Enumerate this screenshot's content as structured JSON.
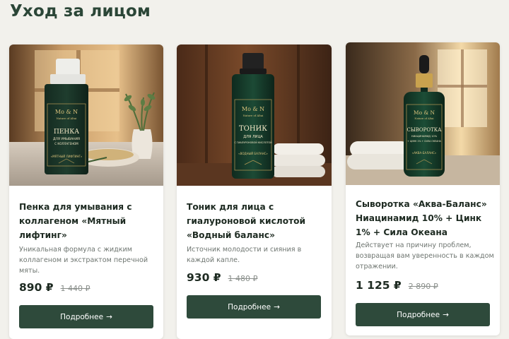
{
  "page": {
    "title": "Уход за лицом"
  },
  "colors": {
    "accent": "#2e4a3b",
    "title": "#2b4637",
    "background": "#f2f1ec"
  },
  "products": [
    {
      "name": "Пенка для умывания с коллагеном «Мятный лифтинг»",
      "description": "Уникальная формула с жидким коллагеном и экстрактом перечной мяты.",
      "price": "890 ₽",
      "old_price": "1 440 ₽",
      "button_label": "Подробнее",
      "button_icon": "arrow-right-icon",
      "image": {
        "brand": "Mo & N",
        "brand_sub": "Nature of Altai",
        "product_line1": "ПЕНКА",
        "product_line2": "ДЛЯ УМЫВАНИЯ",
        "product_line3": "С КОЛЛАГЕНОМ",
        "product_variant": "«МЯТНЫЙ ЛИФТИНГ»"
      }
    },
    {
      "name": "Тоник для лица с гиалуроновой кислотой «Водный баланс»",
      "description": "Источник молодости и сияния в каждой капле.",
      "price": "930 ₽",
      "old_price": "1 480 ₽",
      "button_label": "Подробнее",
      "button_icon": "arrow-right-icon",
      "image": {
        "brand": "Mo & N",
        "brand_sub": "Nature of Altai",
        "product_line1": "ТОНИК",
        "product_line2": "ДЛЯ ЛИЦА",
        "product_line3": "С ГИАЛУРОНОВОЙ КИСЛОТОЙ",
        "product_variant": "«ВОДНЫЙ БАЛАНС»"
      }
    },
    {
      "name": "Сыворотка «Аква-Баланс» Ниацинамид 10% + Цинк 1% + Сила Океана",
      "description": "Действует на причину проблем, возвращая вам уверенность в каждом отражении.",
      "price": "1 125 ₽",
      "old_price": "2 890 ₽",
      "button_label": "Подробнее",
      "button_icon": "arrow-right-icon",
      "image": {
        "brand": "Mo & N",
        "brand_sub": "Nature of Altai",
        "product_line1": "СЫВОРОТКА",
        "product_line2": "НИАЦИНАМИД 10%",
        "product_line3": "+ ЦИНК 1% + СИЛА ОКЕАНА",
        "product_variant": "«АКВА-БАЛАНС»"
      }
    }
  ]
}
